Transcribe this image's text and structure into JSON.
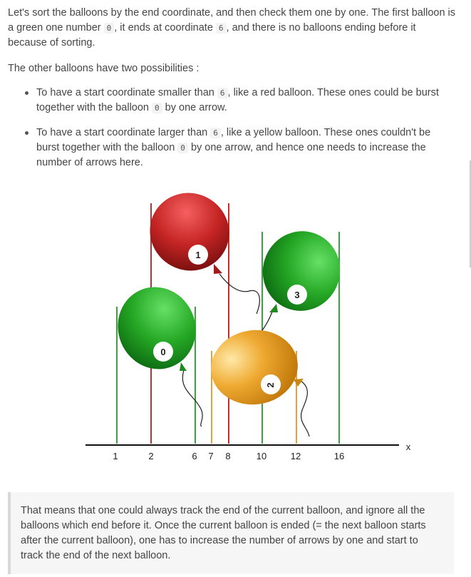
{
  "paragraph1": {
    "t1": "Let's sort the balloons by the end coordinate, and then check them one by one. The first balloon is a green one number ",
    "c1": "0",
    "t2": ", it ends at coordinate ",
    "c2": "6",
    "t3": ", and there is no balloons ending before it because of sorting."
  },
  "paragraph2": {
    "text": "The other balloons have two possibilities :"
  },
  "bullets": [
    {
      "t1": "To have a start coordinate smaller than ",
      "c1": "6",
      "t2": ", like a red balloon. These ones could be burst together with the balloon ",
      "c2": "0",
      "t3": " by one arrow."
    },
    {
      "t1": "To have a start coordinate larger than ",
      "c1": "6",
      "t2": ", like a yellow balloon. These ones couldn't be burst together with the balloon ",
      "c2": "0",
      "t3": " by one arrow, and hence one needs to increase the number of arrows here."
    }
  ],
  "diagram": {
    "axis_label": "x",
    "ticks": [
      "1",
      "2",
      "6",
      "7",
      "8",
      "10",
      "12",
      "16"
    ],
    "balloons": [
      {
        "label": "0",
        "color": "#2aa82a"
      },
      {
        "label": "1",
        "color": "#cc2a2a"
      },
      {
        "label": "2",
        "color": "#e8a020"
      },
      {
        "label": "3",
        "color": "#2aa82a"
      }
    ],
    "line_colors": {
      "green": "#3aa53a",
      "red": "#b83232",
      "orange": "#e2a334"
    }
  },
  "quote": {
    "text": "That means that one could always track the end of the current balloon, and ignore all the balloons which end before it. Once the current balloon is ended (= the next balloon starts after the current balloon), one has to increase the number of arrows by one and start to track the end of the next balloon."
  }
}
